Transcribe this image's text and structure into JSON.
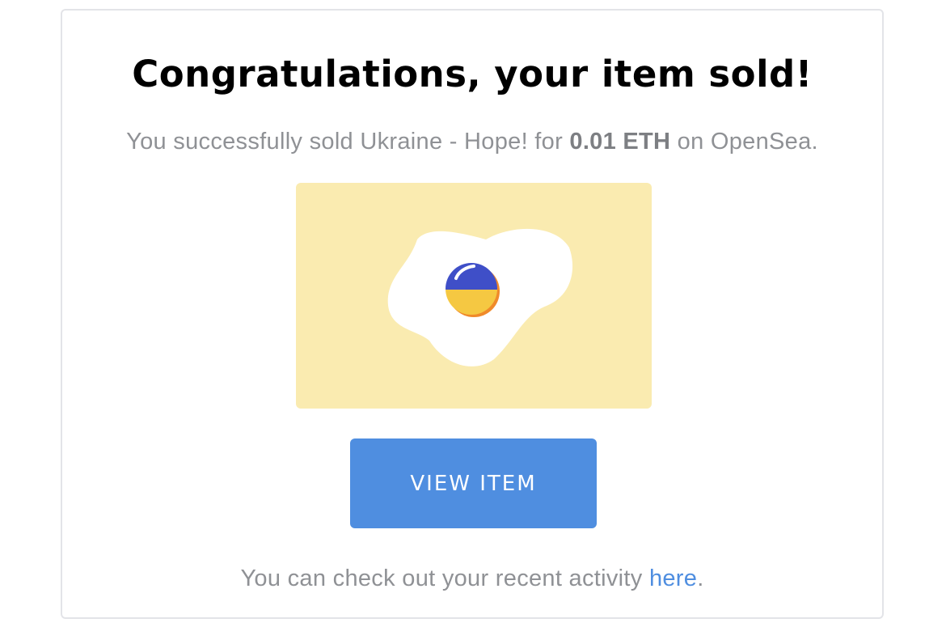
{
  "email": {
    "title": "Congratulations, your item sold!",
    "subtitle": {
      "prefix": "You successfully sold Ukraine - Hope! for ",
      "price": "0.01 ETH",
      "suffix": " on OpenSea."
    },
    "item_image": {
      "icon": "fried-egg-ukraine-flag-icon",
      "background_color": "#faebb0",
      "yolk_top_color": "#3f4fc8",
      "yolk_bottom_color": "#f5c842"
    },
    "view_button": {
      "label": "VIEW ITEM",
      "color": "#4f8ee0"
    },
    "footer": {
      "prefix": "You can check out your recent activity ",
      "link_label": "here",
      "suffix": "."
    }
  }
}
